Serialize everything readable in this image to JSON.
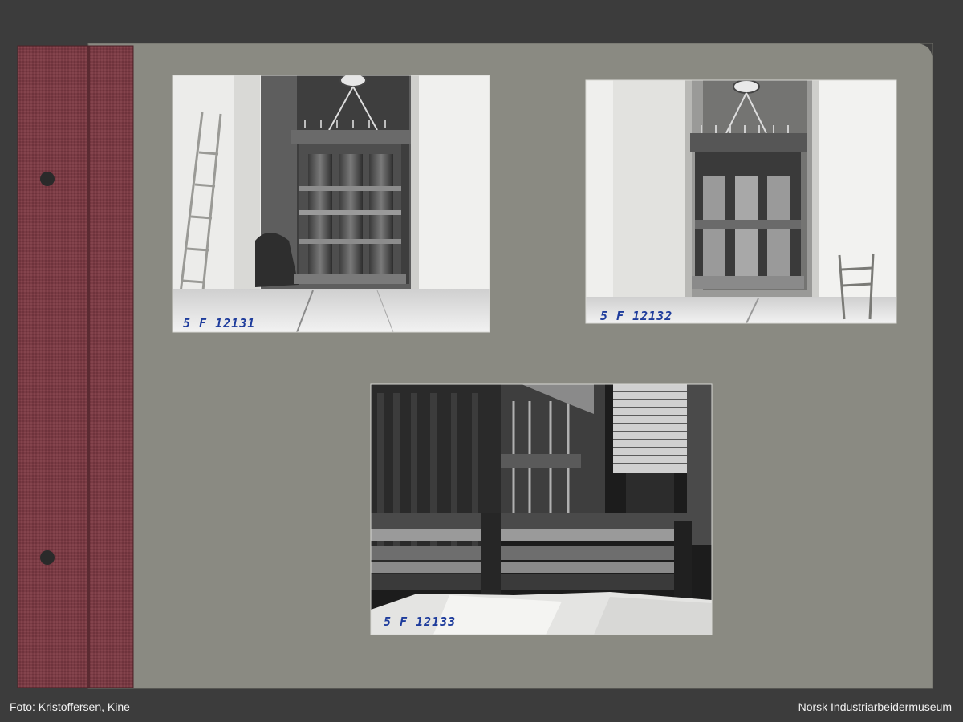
{
  "credits": {
    "photographer": "Foto: Kristoffersen, Kine",
    "museum": "Norsk Industriarbeidermuseum"
  },
  "album": {
    "page_color": "#8a8a82",
    "spine_color": "#7a3b44",
    "photos": [
      {
        "label": "5 F 12131",
        "scene": "transformer-core-in-shop-with-ladder",
        "tone": "light"
      },
      {
        "label": "5 F 12132",
        "scene": "transformer-core-closeup-with-chair",
        "tone": "light"
      },
      {
        "label": "5 F 12133",
        "scene": "transformer-base-detail",
        "tone": "dark"
      }
    ]
  }
}
